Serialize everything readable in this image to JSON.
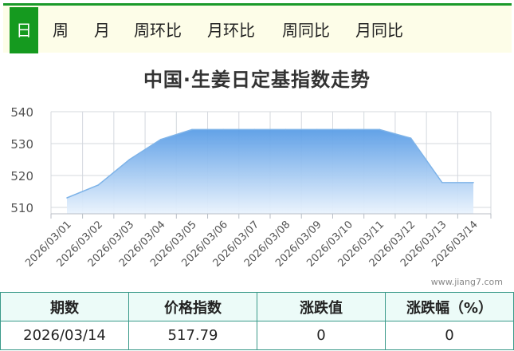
{
  "tabs": [
    {
      "label": "日",
      "active": true
    },
    {
      "label": "周",
      "active": false
    },
    {
      "label": "月",
      "active": false
    },
    {
      "label": "周环比",
      "active": false
    },
    {
      "label": "月环比",
      "active": false
    },
    {
      "label": "周同比",
      "active": false
    },
    {
      "label": "月同比",
      "active": false
    }
  ],
  "colors": {
    "accent": "#159a1f",
    "series_line": "#7eb3e8",
    "series_fill_top": "#5a9de6"
  },
  "watermark": "www.jiang7.com",
  "chart_data": {
    "type": "area",
    "title": "中国·生姜日定基指数走势",
    "categories": [
      "2026/03/01",
      "2026/03/02",
      "2026/03/03",
      "2026/03/04",
      "2026/03/05",
      "2026/03/06",
      "2026/03/07",
      "2026/03/08",
      "2026/03/09",
      "2026/03/10",
      "2026/03/11",
      "2026/03/12",
      "2026/03/13",
      "2026/03/14"
    ],
    "values": [
      513.0,
      517.0,
      525.0,
      531.3,
      534.4,
      534.4,
      534.4,
      534.4,
      534.4,
      534.4,
      534.4,
      531.7,
      517.8,
      517.79
    ],
    "ylim": [
      508,
      540
    ],
    "yticks": [
      510,
      520,
      530,
      540
    ],
    "grid": true,
    "xlabel": "",
    "ylabel": ""
  },
  "summary": {
    "headers": [
      "期数",
      "价格指数",
      "涨跌值",
      "涨跌幅（%）"
    ],
    "row": [
      "2026/03/14",
      "517.79",
      "0",
      "0"
    ]
  }
}
